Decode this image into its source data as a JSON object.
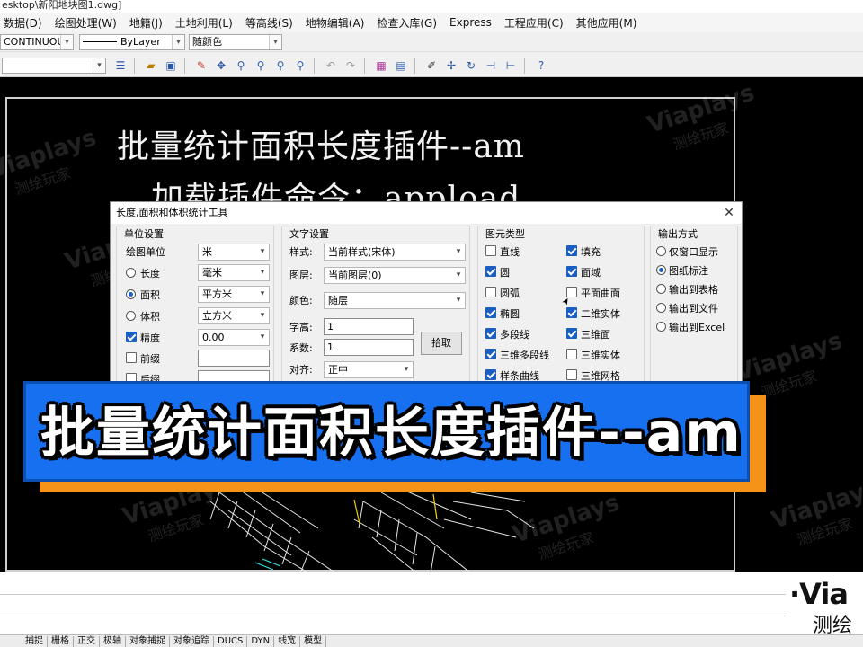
{
  "window": {
    "title": "esktop\\新阳地块图1.dwg]"
  },
  "menu": [
    "数据(D)",
    "绘图处理(W)",
    "地籍(J)",
    "土地利用(L)",
    "等高线(S)",
    "地物编辑(A)",
    "检查入库(G)",
    "Express",
    "工程应用(C)",
    "其他应用(M)"
  ],
  "properties": {
    "linetype": "CONTINUOUS",
    "lineweight": "ByLayer",
    "color": "随颜色"
  },
  "canvas": {
    "line1": "批量统计面积长度插件--am",
    "line2": "加载插件命令：appload",
    "watermark_brand": "Viaplays",
    "watermark_sub": "测绘玩家"
  },
  "dialog": {
    "title": "长度,面积和体积统计工具",
    "unit_group": {
      "title": "单位设置",
      "drawing_unit_label": "绘图单位",
      "drawing_unit_value": "米",
      "rows": [
        {
          "label": "长度",
          "value": "毫米",
          "checked": false
        },
        {
          "label": "面积",
          "value": "平方米",
          "checked": true
        },
        {
          "label": "体积",
          "value": "立方米",
          "checked": false
        }
      ],
      "precision_label": "精度",
      "precision_value": "0.00",
      "prefix_label": "前缀",
      "suffix_label": "后缀"
    },
    "text_group": {
      "title": "文字设置",
      "style_label": "样式:",
      "style_value": "当前样式(宋体)",
      "layer_label": "图层:",
      "layer_value": "当前图层(0)",
      "color_label": "颜色:",
      "color_value": "随层",
      "height_label": "字高:",
      "height_value": "1",
      "scale_label": "系数:",
      "scale_value": "1",
      "align_label": "对齐:",
      "align_value": "正中",
      "pick_button": "拾取"
    },
    "element_group": {
      "title": "图元类型",
      "items": [
        {
          "label": "直线",
          "checked": false
        },
        {
          "label": "填充",
          "checked": true
        },
        {
          "label": "圆",
          "checked": true
        },
        {
          "label": "面域",
          "checked": true
        },
        {
          "label": "圆弧",
          "checked": false
        },
        {
          "label": "平面曲面",
          "checked": false
        },
        {
          "label": "椭圆",
          "checked": true
        },
        {
          "label": "二维实体",
          "checked": true
        },
        {
          "label": "多段线",
          "checked": true
        },
        {
          "label": "三维面",
          "checked": true
        },
        {
          "label": "三维多段线",
          "checked": true
        },
        {
          "label": "三维实体",
          "checked": false
        },
        {
          "label": "样条曲线",
          "checked": true
        },
        {
          "label": "三维网格",
          "checked": false
        }
      ]
    },
    "output_group": {
      "title": "输出方式",
      "options": [
        {
          "label": "仅窗口显示",
          "selected": false
        },
        {
          "label": "图纸标注",
          "selected": true
        },
        {
          "label": "输出到表格",
          "selected": false
        },
        {
          "label": "输出到文件",
          "selected": false
        },
        {
          "label": "输出到Excel",
          "selected": false
        }
      ]
    }
  },
  "banner": {
    "text": "批量统计面积长度插件--am"
  },
  "status": [
    "捕捉",
    "栅格",
    "正交",
    "极轴",
    "对象捕捉",
    "对象追踪",
    "DUCS",
    "DYN",
    "线宽",
    "模型"
  ],
  "logo": {
    "brand": "·Via",
    "sub": "测绘"
  },
  "colors": {
    "banner_blue": "#1670f0",
    "banner_orange": "#f49317",
    "checkbox_blue": "#1a5fc0"
  }
}
